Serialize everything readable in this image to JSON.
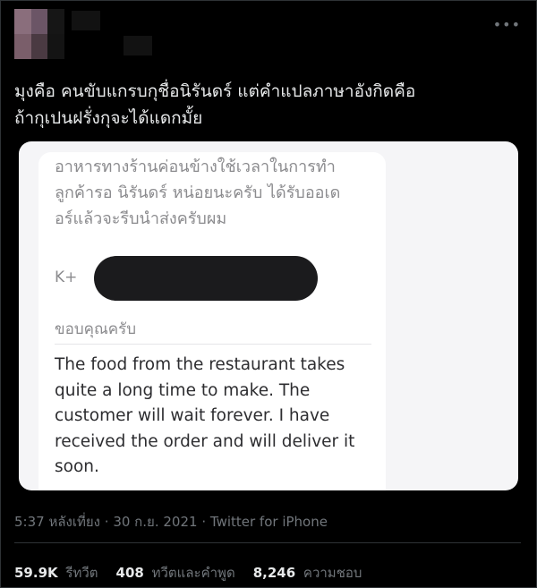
{
  "tweet": {
    "text": "มุงคือ คนขับแกรบกุชื่อนิรันดร์ แต่คำแปลภาษาอังกิดคือ\nถ้ากุเปนฝรั่งกุจะได้แดกมั้ย",
    "more_icon": "more-horizontal-icon",
    "time": "5:37 หลังเที่ยง",
    "date": "30 ก.ย. 2021",
    "source": "Twitter for iPhone",
    "separator": "·"
  },
  "screenshot": {
    "thai_message": "อาหารทางร้านค่อนข้างใช้เวลาในการทำ\nลูกค้ารอ นิรันดร์ หน่อยนะครับ ได้รับออเด\nอร์แล้วจะรีบนำส่งครับผม",
    "sender_prefix": "K+",
    "thanks": "ขอบคุณครับ",
    "translation": "The food from the restaurant takes\nquite a long time to make. The\ncustomer will wait forever. I have\nreceived the order and will deliver it\nsoon."
  },
  "stats": {
    "retweets_count": "59.9K",
    "retweets_label": "รีทวีต",
    "quotes_count": "408",
    "quotes_label": "ทวีตและคำพูด",
    "likes_count": "8,246",
    "likes_label": "ความชอบ"
  }
}
